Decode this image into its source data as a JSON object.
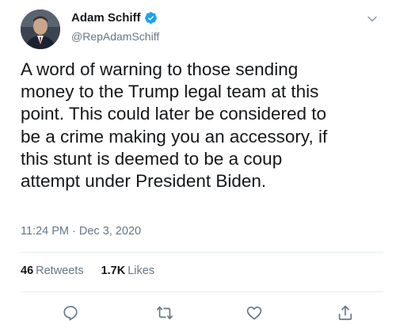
{
  "author": {
    "display_name": "Adam Schiff",
    "handle": "@RepAdamSchiff",
    "verified": true
  },
  "tweet": {
    "text": "A word of warning to those sending\nmoney to the Trump legal team at this\npoint.  This could later be considered to\nbe a crime making you an accessory, if\nthis stunt is deemed to be a coup\nattempt under President Biden.",
    "timestamp": "11:24 PM · Dec 3, 2020"
  },
  "stats": {
    "retweets_count": "46",
    "retweets_label": "Retweets",
    "likes_count": "1.7K",
    "likes_label": "Likes"
  },
  "icons": {
    "verified": "verified-badge-icon",
    "more": "chevron-down-icon",
    "reply": "reply-icon",
    "retweet": "retweet-icon",
    "like": "heart-icon",
    "share": "share-icon"
  },
  "colors": {
    "verified_blue": "#1da1f2",
    "secondary_text": "#657786",
    "primary_text": "#14171a"
  }
}
